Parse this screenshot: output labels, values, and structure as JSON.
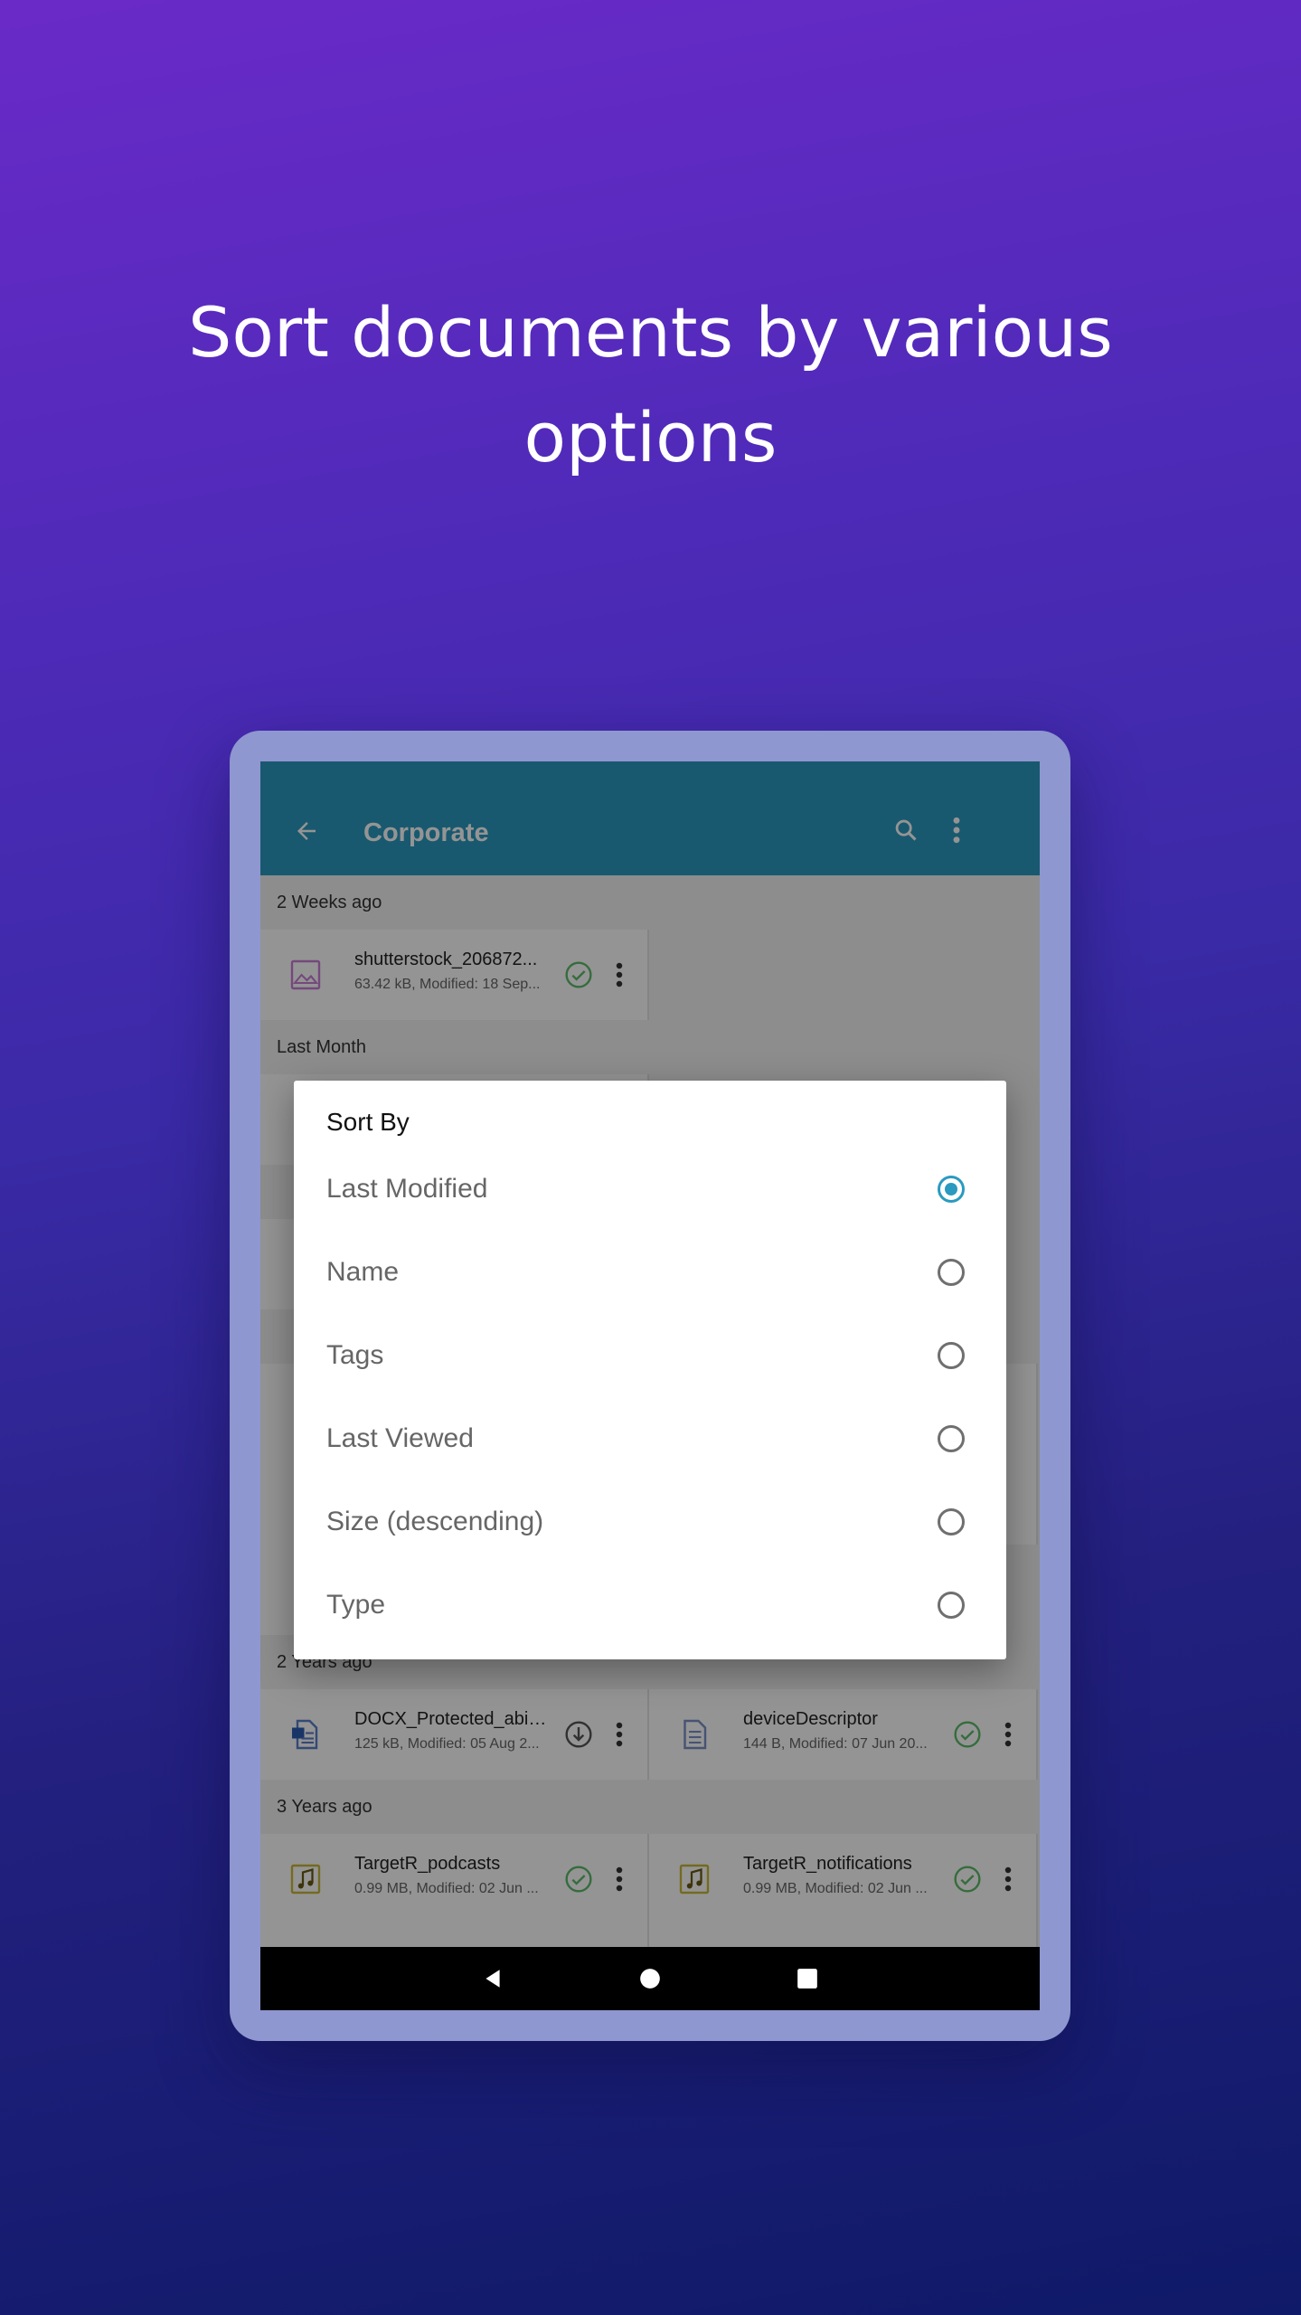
{
  "headline": {
    "line1": "Sort documents by various",
    "line2": "options"
  },
  "appbar": {
    "title": "Corporate",
    "back_icon": "arrow-left-icon",
    "search_icon": "search-icon",
    "more_icon": "more-vert-icon"
  },
  "sections": [
    {
      "header": "2 Weeks ago",
      "files": [
        {
          "name": "shutterstock_206872...",
          "meta": "63.42 kB, Modified: 18 Sep...",
          "icon": "image-file-icon",
          "status": "synced-icon"
        }
      ]
    },
    {
      "header": "Last Month",
      "files": []
    },
    {
      "header": "2 Years ago",
      "files": [
        {
          "name": "DOCX_Protected_abin...",
          "meta": "125 kB, Modified: 05 Aug 2...",
          "icon": "word-file-icon",
          "status": "download-icon"
        },
        {
          "name": "deviceDescriptor",
          "meta": "144 B, Modified: 07 Jun 20...",
          "icon": "text-file-icon",
          "status": "synced-icon"
        }
      ]
    },
    {
      "header": "3 Years ago",
      "files": [
        {
          "name": "TargetR_podcasts",
          "meta": "0.99 MB, Modified: 02 Jun ...",
          "icon": "audio-file-icon",
          "status": "synced-icon"
        },
        {
          "name": "TargetR_notifications",
          "meta": "0.99 MB, Modified: 02 Jun ...",
          "icon": "audio-file-icon",
          "status": "synced-icon"
        }
      ]
    }
  ],
  "dialog": {
    "title": "Sort By",
    "options": [
      {
        "label": "Last Modified",
        "selected": true
      },
      {
        "label": "Name",
        "selected": false
      },
      {
        "label": "Tags",
        "selected": false
      },
      {
        "label": "Last Viewed",
        "selected": false
      },
      {
        "label": "Size (descending)",
        "selected": false
      },
      {
        "label": "Type",
        "selected": false
      }
    ]
  },
  "navbar": {
    "back": "nav-back-icon",
    "home": "nav-home-icon",
    "recents": "nav-recents-icon"
  },
  "colors": {
    "accent": "#2a9ac0",
    "frame": "#8e97cf"
  }
}
